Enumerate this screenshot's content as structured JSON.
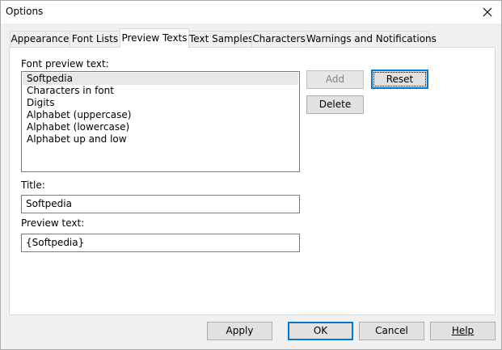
{
  "window": {
    "title": "Options"
  },
  "tabs": [
    {
      "label": "Appearance"
    },
    {
      "label": "Font Lists"
    },
    {
      "label": "Preview Texts"
    },
    {
      "label": "Text Samples"
    },
    {
      "label": "Characters"
    },
    {
      "label": "Warnings and Notifications"
    }
  ],
  "active_tab": "Preview Texts",
  "preview": {
    "list_label": "Font preview text:",
    "items": [
      {
        "label": "Softpedia"
      },
      {
        "label": "Characters in font"
      },
      {
        "label": "Digits"
      },
      {
        "label": "Alphabet (uppercase)"
      },
      {
        "label": "Alphabet (lowercase)"
      },
      {
        "label": "Alphabet up and low"
      }
    ],
    "selected": "Softpedia",
    "title_label": "Title:",
    "title_value": "Softpedia",
    "text_label": "Preview text:",
    "text_value": "{Softpedia}",
    "add_label": "Add",
    "reset_label": "Reset",
    "delete_label": "Delete"
  },
  "footer": {
    "apply_label": "Apply",
    "ok_label": "OK",
    "cancel_label": "Cancel",
    "help_label": "Help"
  },
  "colors": {
    "accent": "#0078d7",
    "panel": "#ffffff",
    "chrome": "#f0f0f0"
  }
}
